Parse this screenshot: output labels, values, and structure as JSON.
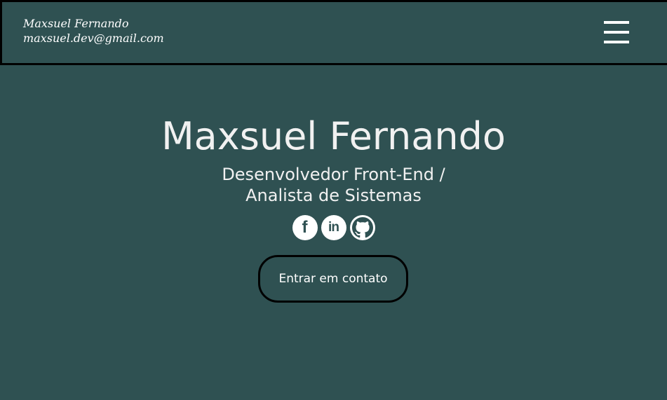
{
  "header": {
    "name": "Maxsuel Fernando",
    "email": "maxsuel.dev@gmail.com",
    "menu_icon": "hamburger-menu-icon"
  },
  "hero": {
    "title": "Maxsuel Fernando",
    "subtitle_line1": "Desenvolvedor Front-End /",
    "subtitle_line2": "Analista de Sistemas",
    "social": [
      {
        "icon": "facebook-icon",
        "glyph": "f"
      },
      {
        "icon": "linkedin-icon",
        "glyph": "in"
      },
      {
        "icon": "github-icon"
      }
    ],
    "cta_label": "Entrar em contato"
  },
  "colors": {
    "background": "#2f5152",
    "text": "#ffffff",
    "border": "#000000"
  }
}
